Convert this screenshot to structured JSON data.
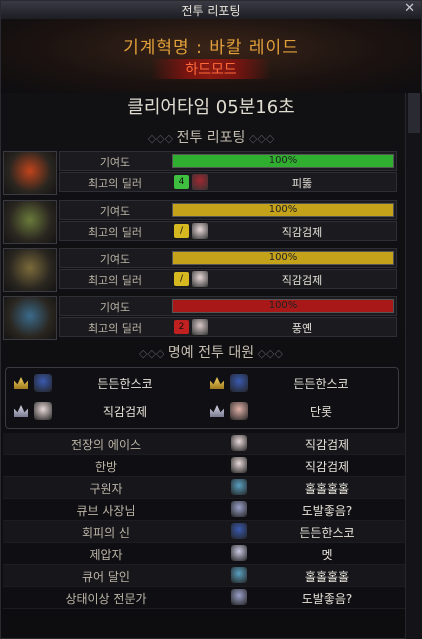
{
  "window": {
    "title": "전투 리포팅",
    "close": "✕"
  },
  "raid_title": "기계혁명 : 바칼 레이드",
  "mode": "하드모드",
  "clear_time": "클리어타임  05분16초",
  "section_report": "전투 리포팅",
  "section_honor": "명예 전투 대원",
  "labels": {
    "contribution": "기여도",
    "top_dealer": "최고의 딜러"
  },
  "bosses": [
    {
      "contribution_pct": 100,
      "pct_text": "100%",
      "bar_color": "#2fae2f",
      "job_badge": "4",
      "job_color": "#3fbf3f",
      "dealer": "피뚫",
      "portrait_color": "#c0441c",
      "avatar_color": "#a02830"
    },
    {
      "contribution_pct": 100,
      "pct_text": "100%",
      "bar_color": "#c4a21a",
      "job_badge": "/",
      "job_color": "#d6b820",
      "dealer": "직감검제",
      "portrait_color": "#6a7a3a",
      "avatar_color": "#e8d8d8"
    },
    {
      "contribution_pct": 100,
      "pct_text": "100%",
      "bar_color": "#c4a21a",
      "job_badge": "/",
      "job_color": "#d6b820",
      "dealer": "직감검제",
      "portrait_color": "#7a6a3a",
      "avatar_color": "#e8d8d8"
    },
    {
      "contribution_pct": 100,
      "pct_text": "100%",
      "bar_color": "#a81818",
      "job_badge": "2",
      "job_color": "#c02020",
      "dealer": "풍옌",
      "portrait_color": "#3a6a8a",
      "avatar_color": "#d8c8c8"
    }
  ],
  "honor_members": [
    {
      "name": "든든한스코",
      "medal": "gold-medal-icon",
      "avatar_color": "#3a5ab0"
    },
    {
      "name": "든든한스코",
      "medal": "gold-medal-icon",
      "avatar_color": "#3a5ab0"
    },
    {
      "name": "직감검제",
      "medal": "silver-medal-icon",
      "avatar_color": "#e8d8d8"
    },
    {
      "name": "단롯",
      "medal": "silver-medal-icon",
      "avatar_color": "#e0b0a8"
    }
  ],
  "awards": [
    {
      "award": "전장의 에이스",
      "player": "직감검제",
      "avatar_color": "#e8d8d8"
    },
    {
      "award": "한방",
      "player": "직감검제",
      "avatar_color": "#e8d8d8"
    },
    {
      "award": "구원자",
      "player": "홀홀홀홀",
      "avatar_color": "#5aa0c0"
    },
    {
      "award": "큐브 사장님",
      "player": "도발좋음?",
      "avatar_color": "#9aa0c8"
    },
    {
      "award": "회피의 신",
      "player": "든든한스코",
      "avatar_color": "#3a5ab0"
    },
    {
      "award": "제압자",
      "player": "멧",
      "avatar_color": "#c8c8e0"
    },
    {
      "award": "큐어 달인",
      "player": "홀홀홀홀",
      "avatar_color": "#5aa0c0"
    },
    {
      "award": "상태이상 전문가",
      "player": "도발좋음?",
      "avatar_color": "#9aa0c8"
    }
  ]
}
